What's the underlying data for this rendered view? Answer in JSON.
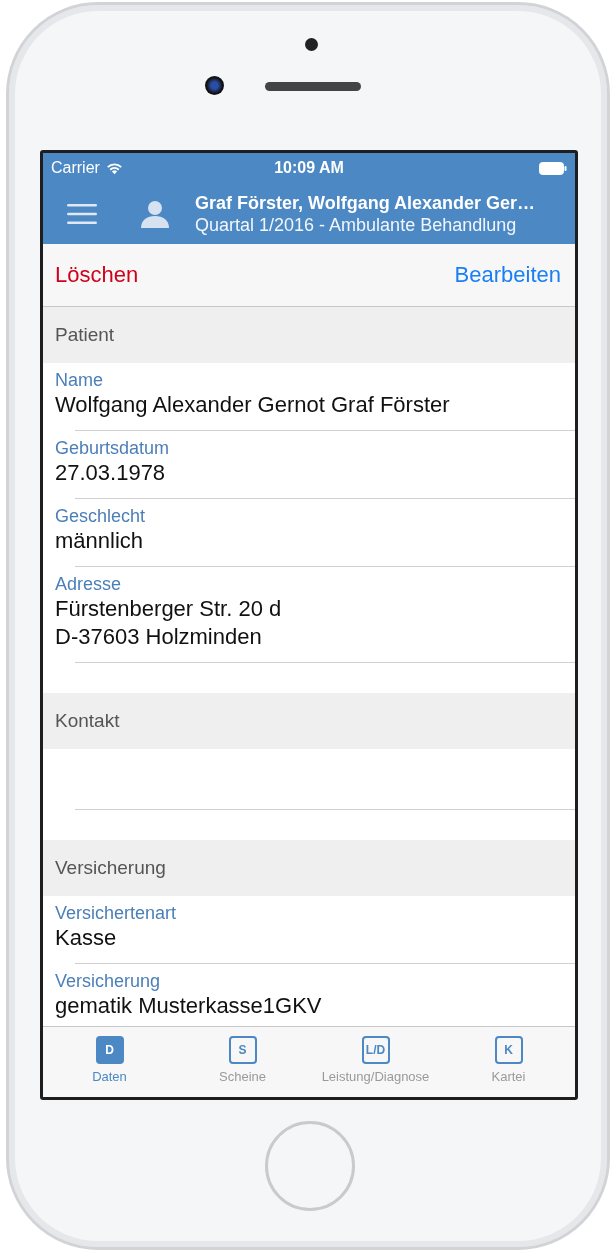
{
  "status_bar": {
    "carrier": "Carrier",
    "time": "10:09 AM"
  },
  "nav_bar": {
    "title": "Graf Förster, Wolfgang Alexander Ger…",
    "subtitle": "Quartal 1/2016 - Ambulante Behandlung"
  },
  "toolbar": {
    "left_action": "Löschen",
    "right_action": "Bearbeiten"
  },
  "sections": [
    {
      "title": "Patient",
      "fields": [
        {
          "label": "Name",
          "value": [
            "Wolfgang Alexander Gernot Graf Förster"
          ]
        },
        {
          "label": "Geburtsdatum",
          "value": [
            "27.03.1978"
          ]
        },
        {
          "label": "Geschlecht",
          "value": [
            "männlich"
          ]
        },
        {
          "label": "Adresse",
          "value": [
            "Fürstenberger Str. 20 d",
            "D-37603 Holzminden"
          ]
        }
      ]
    },
    {
      "title": "Kontakt"
    },
    {
      "title": "Versicherung",
      "fields": [
        {
          "label": "Versichertenart",
          "value": [
            "Kasse"
          ]
        },
        {
          "label": "Versicherung",
          "value": [
            "gematik Musterkasse1GKV"
          ]
        }
      ]
    }
  ],
  "tab_bar": [
    {
      "icon": "D",
      "label": "Daten",
      "selected": true
    },
    {
      "icon": "S",
      "label": "Scheine",
      "selected": false
    },
    {
      "icon": "L/D",
      "label": "Leistung/Diagnose",
      "selected": false
    },
    {
      "icon": "K",
      "label": "Kartei",
      "selected": false
    }
  ]
}
